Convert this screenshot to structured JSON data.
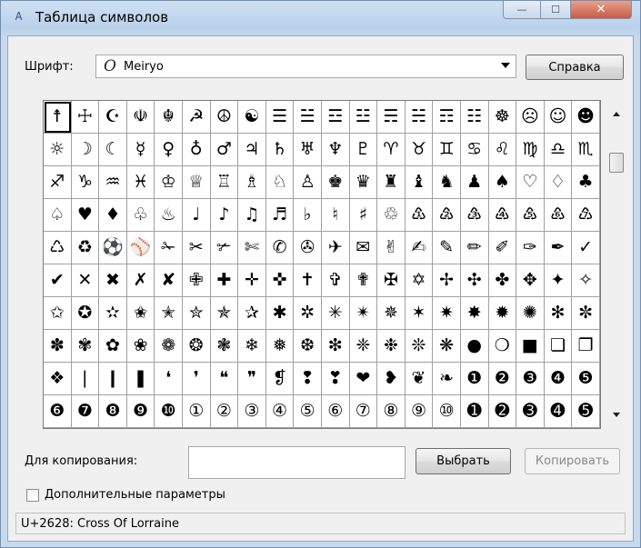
{
  "window": {
    "title": "Таблица символов",
    "app_icon_glyph": "Ꭺ",
    "controls": {
      "minimize": "—",
      "maximize": "☐",
      "close": "✕"
    }
  },
  "font": {
    "label": "Шрифт:",
    "icon_glyph": "O",
    "value": "Meiryo"
  },
  "help_button": "Справка",
  "grid": {
    "selected_index": 0,
    "rows": [
      [
        "☨",
        "☩",
        "☪",
        "☫",
        "☬",
        "☭",
        "☮",
        "☯",
        "☰",
        "☱",
        "☲",
        "☳",
        "☴",
        "☵",
        "☶",
        "☷",
        "☸",
        "☹",
        "☺",
        "☻"
      ],
      [
        "☼",
        "☽",
        "☾",
        "☿",
        "♀",
        "♁",
        "♂",
        "♃",
        "♄",
        "♅",
        "♆",
        "♇",
        "♈",
        "♉",
        "♊",
        "♋",
        "♌",
        "♍",
        "♎",
        "♏"
      ],
      [
        "♐",
        "♑",
        "♒",
        "♓",
        "♔",
        "♕",
        "♖",
        "♗",
        "♘",
        "♙",
        "♚",
        "♛",
        "♜",
        "♝",
        "♞",
        "♟",
        "♠",
        "♡",
        "♢",
        "♣"
      ],
      [
        "♤",
        "♥",
        "♦",
        "♧",
        "♨",
        "♩",
        "♪",
        "♫",
        "♬",
        "♭",
        "♮",
        "♯",
        "♲",
        "♳",
        "♴",
        "♵",
        "♶",
        "♷",
        "♸",
        "♹"
      ],
      [
        "♺",
        "♻",
        "⚽",
        "⚾",
        "✁",
        "✂",
        "✃",
        "✄",
        "✆",
        "✇",
        "✈",
        "✉",
        "✌",
        "✍",
        "✎",
        "✏",
        "✐",
        "✑",
        "✒",
        "✓"
      ],
      [
        "✔",
        "✕",
        "✖",
        "✗",
        "✘",
        "✙",
        "✚",
        "✛",
        "✜",
        "✝",
        "✞",
        "✟",
        "✠",
        "✡",
        "✢",
        "✣",
        "✤",
        "✥",
        "✦",
        "✧"
      ],
      [
        "✩",
        "✪",
        "✫",
        "✬",
        "✭",
        "✮",
        "✯",
        "✰",
        "✱",
        "✲",
        "✳",
        "✴",
        "✵",
        "✶",
        "✷",
        "✸",
        "✹",
        "✺",
        "✻",
        "✼"
      ],
      [
        "✽",
        "✾",
        "✿",
        "❀",
        "❁",
        "❂",
        "❃",
        "❄",
        "❅",
        "❆",
        "❇",
        "❈",
        "❉",
        "❊",
        "❋",
        "●",
        "❍",
        "■",
        "❏",
        "❐"
      ],
      [
        "❖",
        "❘",
        "❙",
        "❚",
        "❛",
        "❜",
        "❝",
        "❞",
        "❡",
        "❢",
        "❣",
        "❤",
        "❥",
        "❦",
        "❧",
        "❶",
        "❷",
        "❸",
        "❹",
        "❺"
      ],
      [
        "❻",
        "❼",
        "❽",
        "❾",
        "❿",
        "①",
        "②",
        "③",
        "④",
        "⑤",
        "⑥",
        "⑦",
        "⑧",
        "⑨",
        "⑩",
        "➊",
        "➋",
        "➌",
        "➍",
        "➎"
      ]
    ]
  },
  "copy": {
    "label": "Для копирования:",
    "value": "",
    "select_button": "Выбрать",
    "copy_button": "Копировать"
  },
  "advanced": {
    "label": "Дополнительные параметры",
    "checked": false
  },
  "status": "U+2628: Cross Of Lorraine"
}
